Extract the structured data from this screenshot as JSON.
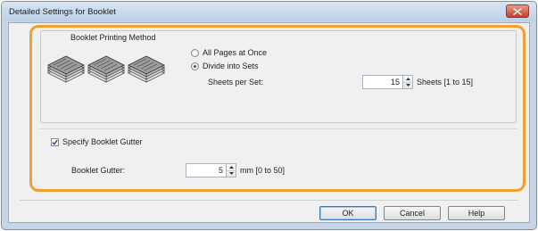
{
  "window": {
    "title": "Detailed Settings for Booklet"
  },
  "booklet_printing_method": {
    "group_label": "Booklet Printing Method",
    "options": [
      {
        "label": "All Pages at Once",
        "selected": false
      },
      {
        "label": "Divide into Sets",
        "selected": true
      }
    ],
    "sheets_per_set": {
      "label": "Sheets per Set:",
      "value": "15",
      "unit": "Sheets [1 to 15]"
    }
  },
  "gutter": {
    "checkbox_label": "Specify Booklet Gutter",
    "checked": true,
    "field_label": "Booklet Gutter:",
    "value": "5",
    "unit": "mm [0 to 50]"
  },
  "buttons": {
    "ok": "OK",
    "cancel": "Cancel",
    "help": "Help"
  },
  "colors": {
    "highlight_frame": "#f0a030",
    "close_button": "#c4412a",
    "title_bar": "#c6d6e8"
  }
}
